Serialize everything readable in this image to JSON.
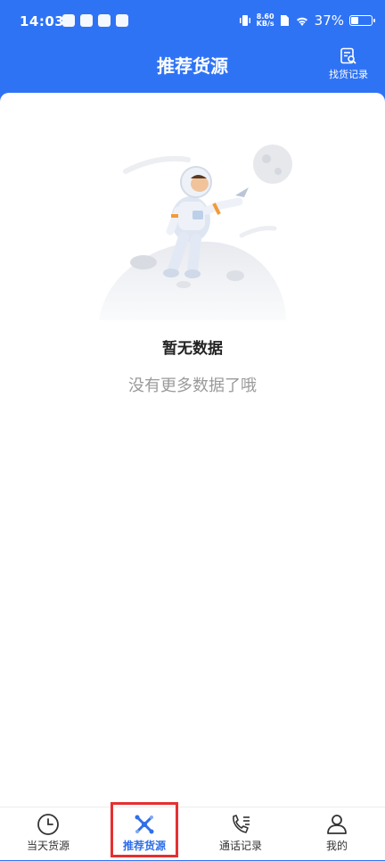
{
  "status_bar": {
    "time": "14:03",
    "net_speed_value": "8.60",
    "net_speed_unit": "KB/s",
    "battery": "37%",
    "battery_level": 0.37
  },
  "header": {
    "title": "推荐货源",
    "record_label": "找货记录"
  },
  "empty_state": {
    "title": "暂无数据",
    "subtitle": "没有更多数据了哦"
  },
  "tabbar": {
    "items": [
      {
        "label": "当天货源",
        "icon": "clock-icon"
      },
      {
        "label": "推荐货源",
        "icon": "recommend-icon",
        "active": true
      },
      {
        "label": "通话记录",
        "icon": "phone-log-icon"
      },
      {
        "label": "我的",
        "icon": "user-icon"
      }
    ]
  },
  "colors": {
    "brand": "#2f73f5",
    "active_tab": "#2f6fe8",
    "highlight_box": "#e53030"
  }
}
